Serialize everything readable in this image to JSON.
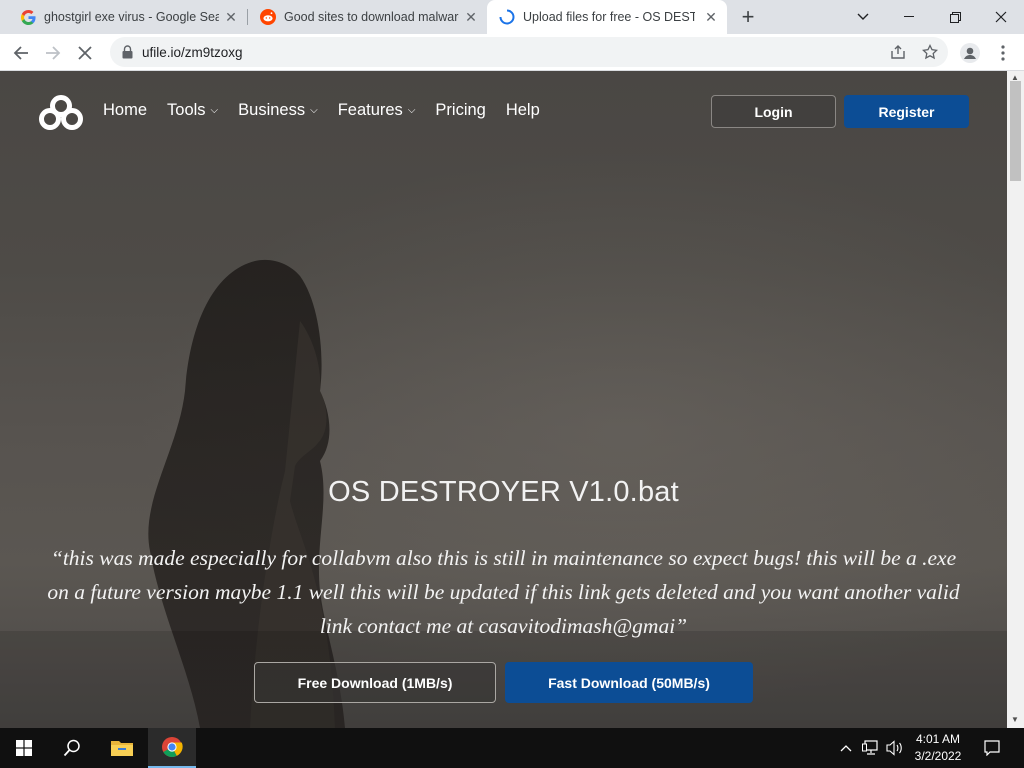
{
  "browser": {
    "tabs": [
      {
        "title": "ghostgirl exe virus - Google Sear",
        "favicon": "google-icon"
      },
      {
        "title": "Good sites to download malware",
        "favicon": "reddit-icon"
      },
      {
        "title": "Upload files for free - OS DESTRO",
        "favicon": "loading-icon",
        "active": true
      }
    ],
    "new_tab_label": "+",
    "url": "ufile.io/zm9tzoxg"
  },
  "site": {
    "nav": [
      {
        "label": "Home",
        "dropdown": false
      },
      {
        "label": "Tools",
        "dropdown": true
      },
      {
        "label": "Business",
        "dropdown": true
      },
      {
        "label": "Features",
        "dropdown": true
      },
      {
        "label": "Pricing",
        "dropdown": false
      },
      {
        "label": "Help",
        "dropdown": false
      }
    ],
    "login_label": "Login",
    "register_label": "Register",
    "file_name": "OS DESTROYER V1.0.bat",
    "description": "“this was made especially for collabvm also this is still in maintenance so expect bugs! this will be a .exe on a future version maybe 1.1 well this will be updated if this link gets deleted and you want another valid link contact me at casavitodimash@gmai”",
    "free_download_label": "Free Download (1MB/s)",
    "fast_download_label": "Fast Download (50MB/s)",
    "accent_color": "#0c4d95"
  },
  "taskbar": {
    "time": "4:01 AM",
    "date": "3/2/2022"
  }
}
